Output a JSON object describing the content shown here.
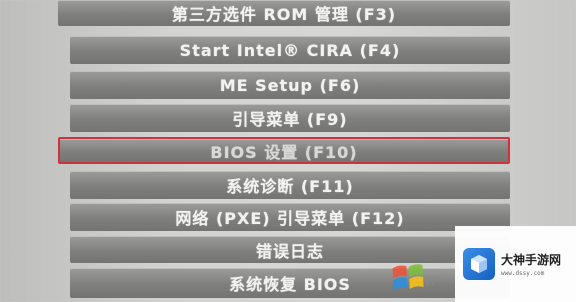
{
  "menu_items": [
    "第三方选件 ROM 管理 (F3)",
    "Start Intel® CIRA (F4)",
    "ME Setup (F6)",
    "引导菜单 (F9)",
    "BIOS 设置 (F10)",
    "系统诊断 (F11)",
    "网络 (PXE) 引导菜单 (F12)",
    "错误日志",
    "系统恢复 BIOS"
  ],
  "selected_item": "BIOS 设置 (F10)",
  "watermark": {
    "brand": "大神手游网",
    "url": "www.dssy.com"
  },
  "colors": {
    "selection_border": "#d0313c",
    "item_bg": "#808080"
  }
}
